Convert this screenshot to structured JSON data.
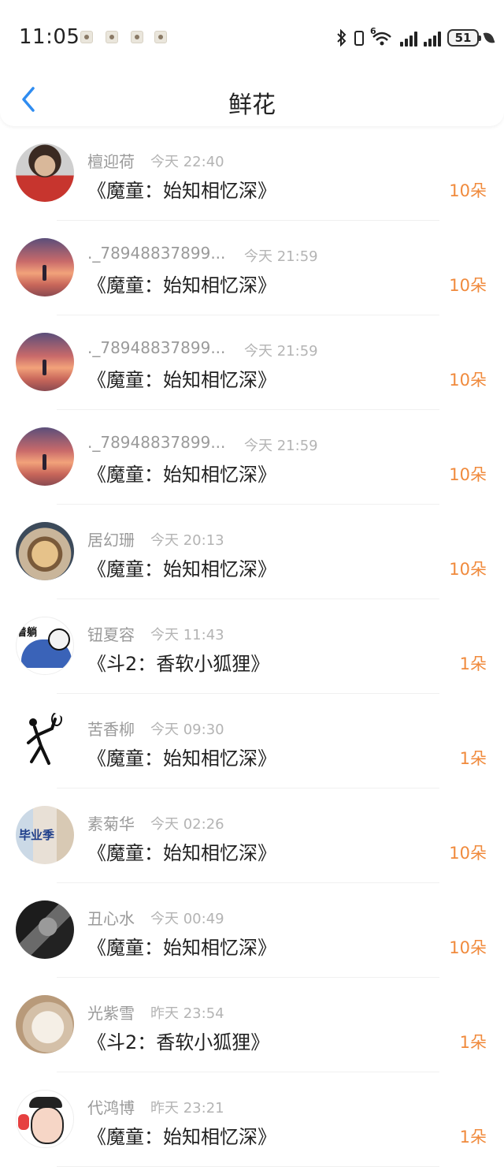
{
  "status_bar": {
    "time": "11:05",
    "notification_icons": [
      "app-notification-icon",
      "app-notification-icon",
      "app-notification-icon",
      "app-notification-icon"
    ],
    "network_label": "6",
    "battery": "51"
  },
  "nav": {
    "back_icon": "chevron-left-icon",
    "title": "鲜花",
    "accent_color": "#2f8cf0"
  },
  "colors": {
    "count": "#f08a3c",
    "name": "#9a9a9a",
    "time": "#b4b4b4"
  },
  "items": [
    {
      "name": "檀迎荷",
      "time": "今天 22:40",
      "gift": "《魔童：始知相忆深》",
      "count": "10朵",
      "avatar": "portrait-avatar"
    },
    {
      "name": "._78948837899...",
      "time": "今天 21:59",
      "gift": "《魔童：始知相忆深》",
      "count": "10朵",
      "avatar": "sunset-avatar"
    },
    {
      "name": "._78948837899...",
      "time": "今天 21:59",
      "gift": "《魔童：始知相忆深》",
      "count": "10朵",
      "avatar": "sunset-avatar"
    },
    {
      "name": "._78948837899...",
      "time": "今天 21:59",
      "gift": "《魔童：始知相忆深》",
      "count": "10朵",
      "avatar": "sunset-avatar"
    },
    {
      "name": "居幻珊",
      "time": "今天 20:13",
      "gift": "《魔童：始知相忆深》",
      "count": "10朵",
      "avatar": "food-avatar"
    },
    {
      "name": "钮夏容",
      "time": "今天 11:43",
      "gift": "《斗2：香软小狐狸》",
      "count": "1朵",
      "avatar": "meme-avatar",
      "avatar_text": "着躺"
    },
    {
      "name": "苦香柳",
      "time": "今天 09:30",
      "gift": "《魔童：始知相忆深》",
      "count": "1朵",
      "avatar": "stick-figure-avatar"
    },
    {
      "name": "素菊华",
      "time": "今天 02:26",
      "gift": "《魔童：始知相忆深》",
      "count": "10朵",
      "avatar": "graduation-avatar",
      "avatar_text": "毕业季"
    },
    {
      "name": "丑心水",
      "time": "今天 00:49",
      "gift": "《魔童：始知相忆深》",
      "count": "10朵",
      "avatar": "bw-portrait-avatar"
    },
    {
      "name": "光紫雪",
      "time": "昨天 23:54",
      "gift": "《斗2：香软小狐狸》",
      "count": "1朵",
      "avatar": "cat-avatar"
    },
    {
      "name": "代鸿博",
      "time": "昨天 23:21",
      "gift": "《魔童：始知相忆深》",
      "count": "1朵",
      "avatar": "cartoon-avatar"
    }
  ]
}
